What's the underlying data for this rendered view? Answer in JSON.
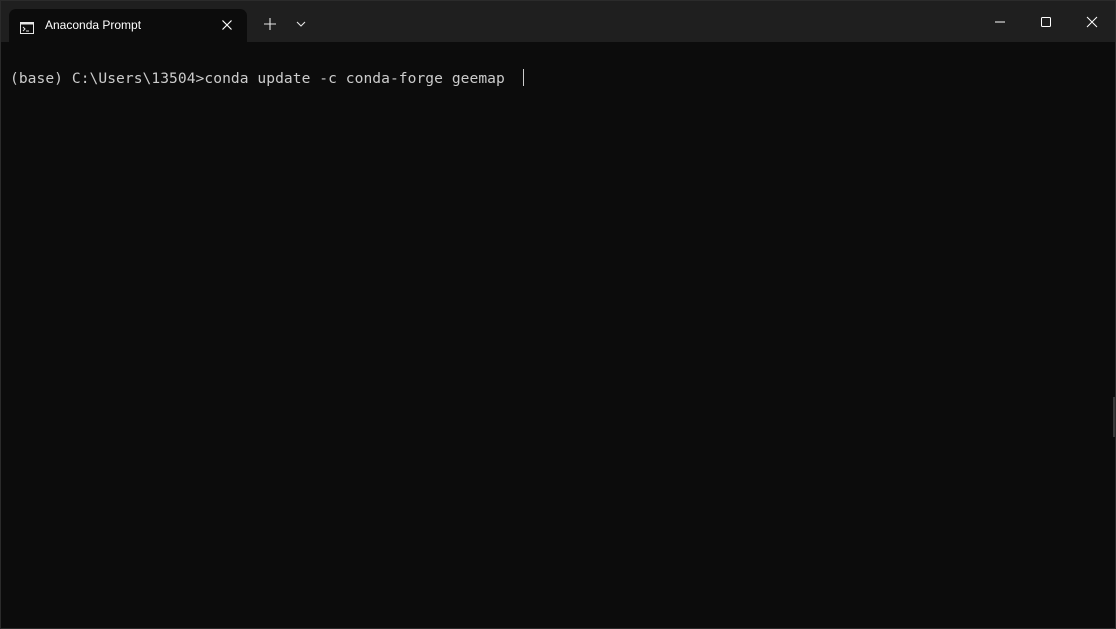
{
  "window": {
    "title_tab": "Anaconda Prompt",
    "icons": {
      "tab_icon": "terminal-icon",
      "tab_close": "close-icon",
      "new_tab": "plus-icon",
      "dropdown": "chevron-down-icon",
      "minimize": "minimize-icon",
      "maximize": "maximize-icon",
      "close": "close-icon"
    },
    "colors": {
      "titlebar": "#1f1f1f",
      "background": "#0c0c0c",
      "text": "#cccccc"
    }
  },
  "terminal": {
    "prompt": "(base) C:\\Users\\13504>",
    "command": "conda update -c conda-forge geemap "
  }
}
